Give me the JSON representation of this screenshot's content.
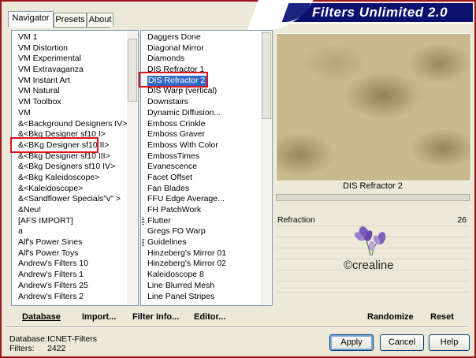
{
  "tabs": [
    "Navigator",
    "Presets",
    "About"
  ],
  "app_title": "Filters Unlimited 2.0",
  "categories": [
    "VM 1",
    "VM Distortion",
    "VM Experimental",
    "VM Extravaganza",
    "VM Instant Art",
    "VM Natural",
    "VM Toolbox",
    "VM",
    "&<Background Designers IV>",
    "&<Bkg Designer sf10 I>",
    "&<BKg Designer sf10 II>",
    "&<Bkg Designer sf10 III>",
    "&<Bkg Designers sf10 IV>",
    "&<Bkg Kaleidoscope>",
    "&<Kaleidoscope>",
    "&<Sandflower Specials\"v\" >",
    "&Neu!",
    "[AFS IMPORT]",
    "a",
    "Alf's Power Sines",
    "Alf's Power Toys",
    "Andrew's Filters 10",
    "Andrew's Filters 1",
    "Andrew's Filters 25",
    "Andrew's Filters 2"
  ],
  "categories_selected_index": 10,
  "filters": [
    "Daggers Done",
    "Diagonal Mirror",
    "Diamonds",
    "DIS Refractor 1",
    "DIS Refractor 2",
    "DIS Warp (vertical)",
    "Downstairs",
    "Dynamic Diffusion...",
    "Emboss Crinkle",
    "Emboss Graver",
    "Emboss With Color",
    "EmbossTimes",
    "Evanescence",
    "Facet Offset",
    "Fan Blades",
    "FFU Edge Average...",
    "FH PatchWork",
    "Flutter",
    "Gregs FO Warp",
    "Guidelines",
    "Hinzeberg's Mirror 01",
    "Hinzeberg's Mirror 02",
    "Kaleidoscope 8",
    "Line Blurred Mesh",
    "Line Panel Stripes"
  ],
  "filters_separators": [
    17,
    19
  ],
  "filters_selected_index": 4,
  "selected_filter_name": "DIS Refractor 2",
  "parameter": {
    "label": "Refraction",
    "value": "26"
  },
  "watermark_text": "©crealine",
  "toolbar": {
    "database": "Database",
    "import": "Import...",
    "filter_info": "Filter Info...",
    "editor": "Editor...",
    "randomize": "Randomize",
    "reset": "Reset"
  },
  "info": {
    "database_label": "Database:",
    "database_value": "ICNET-Filters",
    "filters_label": "Filters:",
    "filters_value": "2422"
  },
  "buttons": {
    "apply": "Apply",
    "cancel": "Cancel",
    "help": "Help"
  },
  "colors": {
    "selection": "#3169c6",
    "highlight_box": "#d9141c",
    "banner": "#0b0f6e"
  }
}
